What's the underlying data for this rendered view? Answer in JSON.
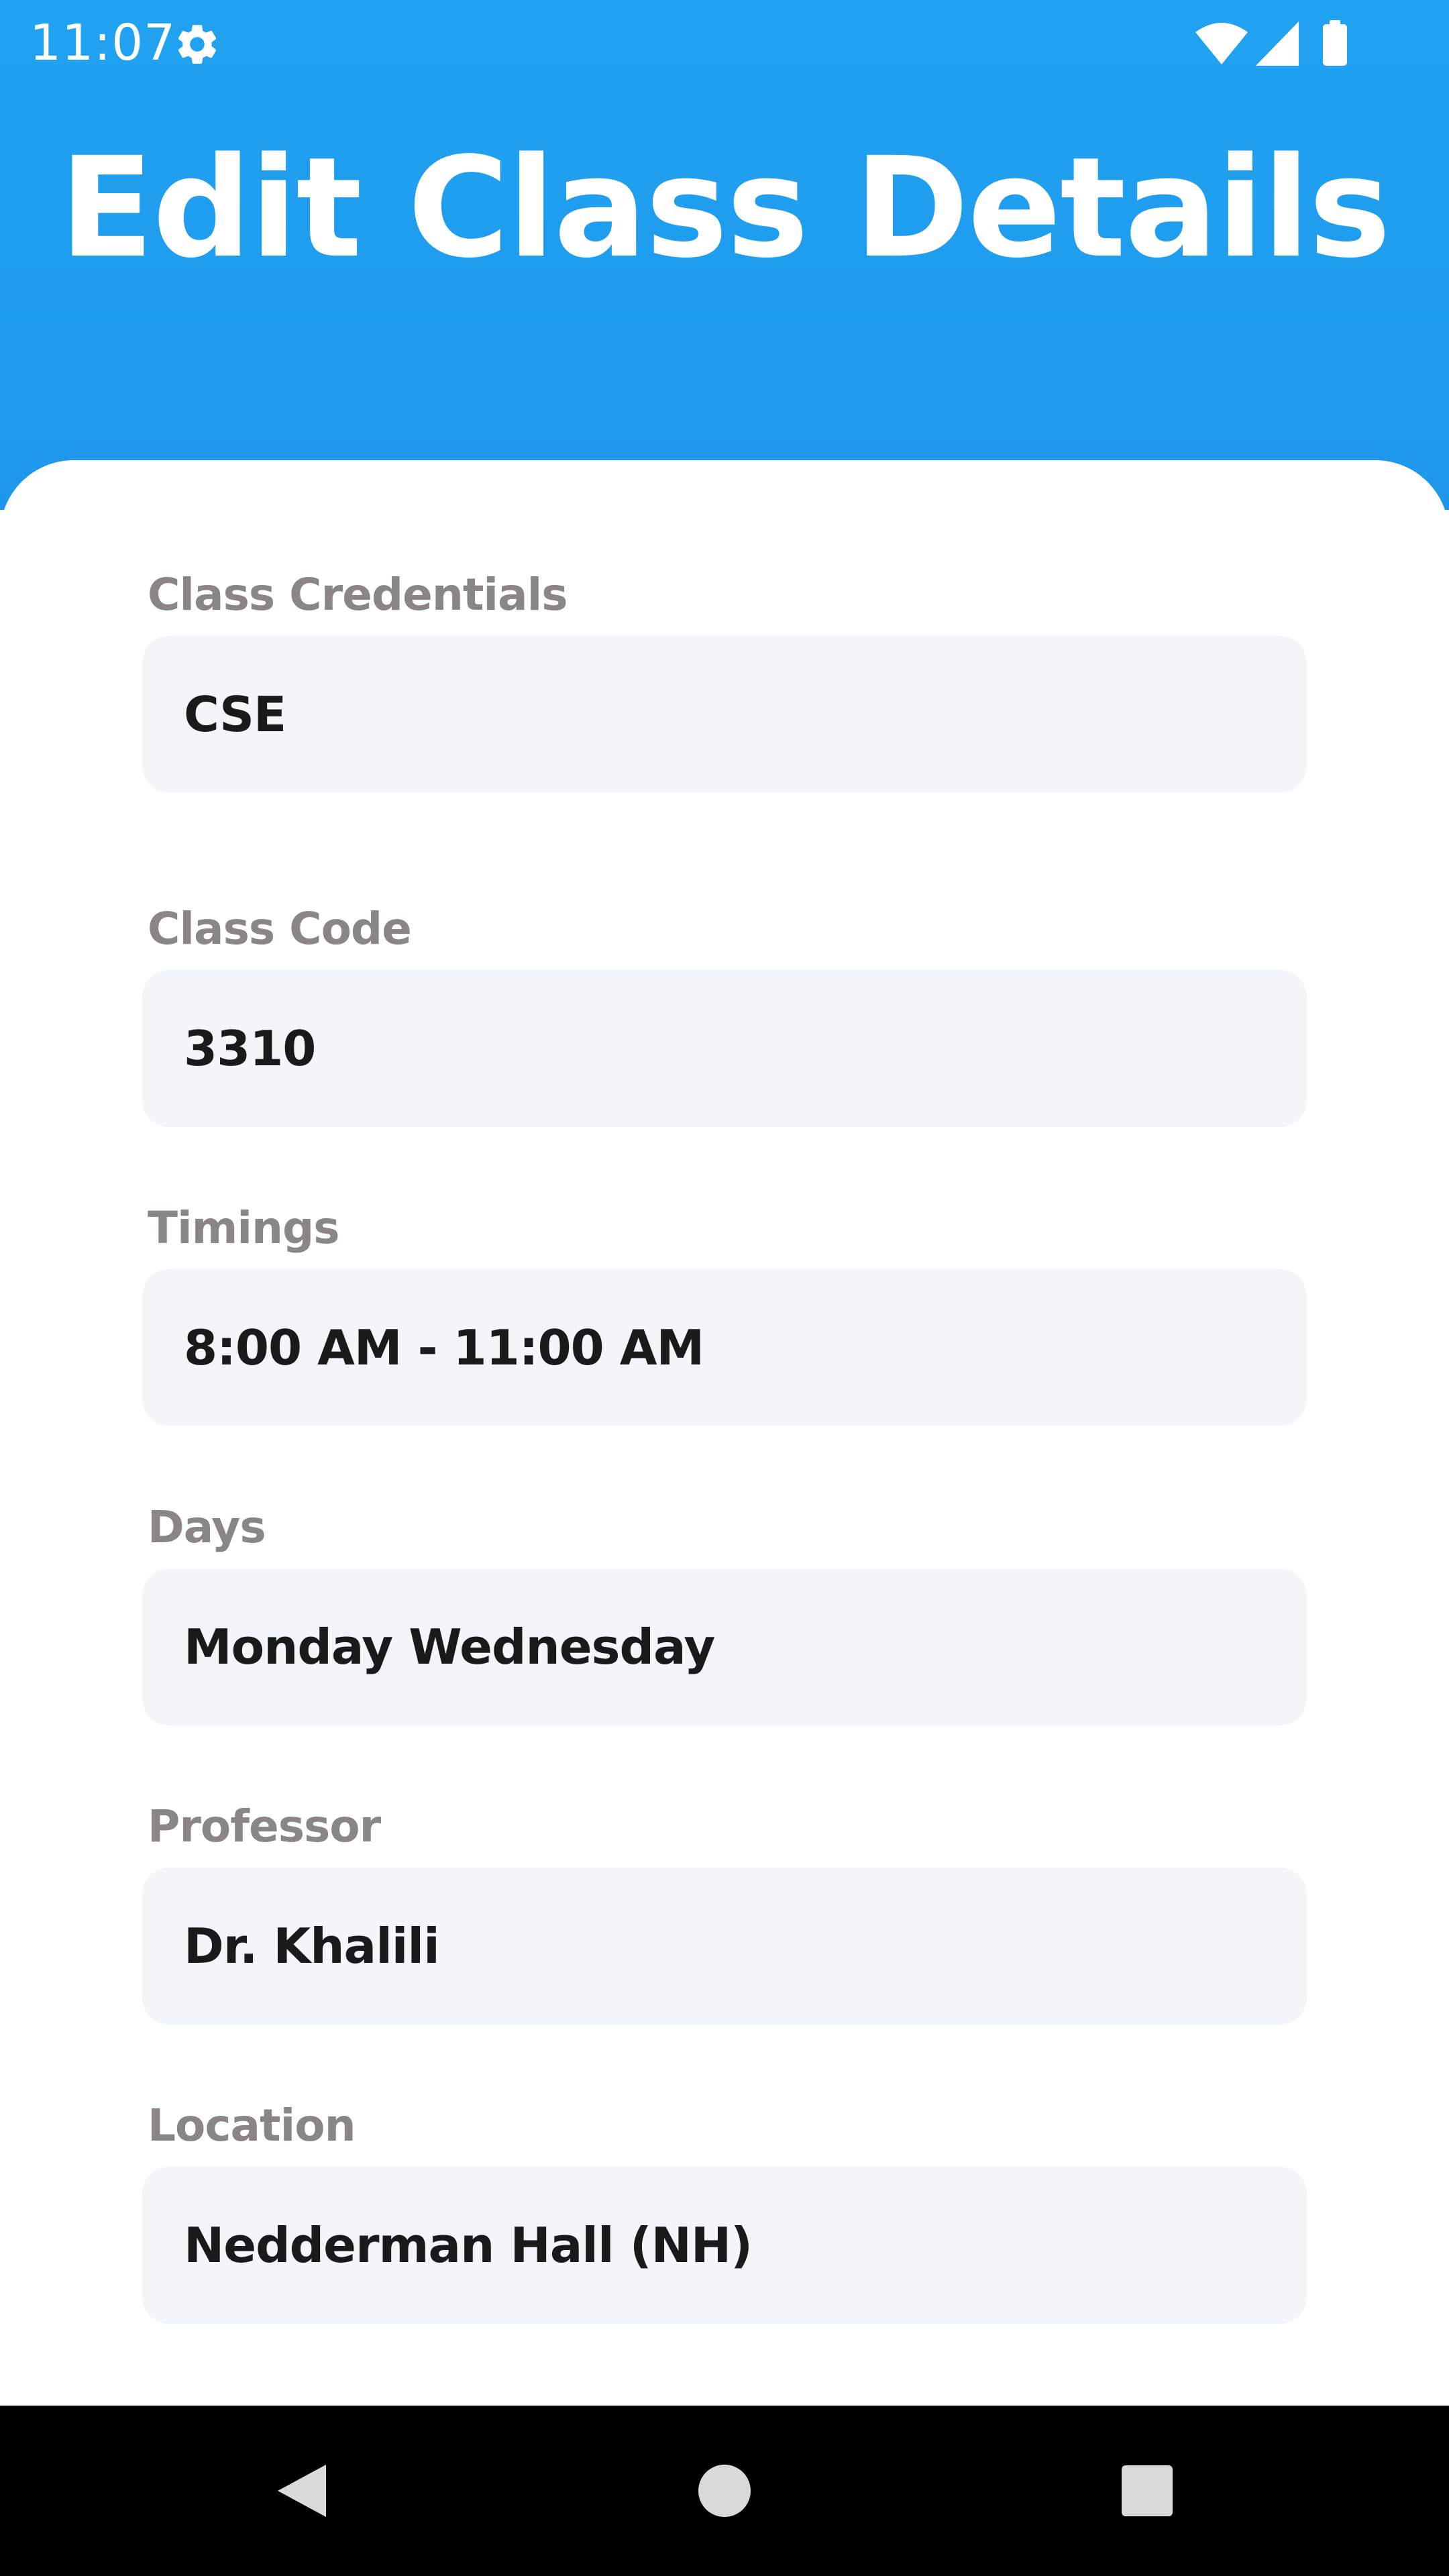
{
  "status_bar": {
    "time": "11:07",
    "icons": [
      "gear-icon",
      "wifi-icon",
      "cell-signal-icon",
      "battery-icon"
    ]
  },
  "header": {
    "title": "Edit Class Details",
    "background_color": "#21a3f1"
  },
  "form": {
    "fields": [
      {
        "label": "Class Credentials",
        "value": "CSE"
      },
      {
        "label": "Class Code",
        "value": "3310"
      },
      {
        "label": "Timings",
        "value": "8:00 AM - 11:00 AM"
      },
      {
        "label": "Days",
        "value": "Monday Wednesday"
      },
      {
        "label": "Professor",
        "value": "Dr. Khalili"
      },
      {
        "label": "Location",
        "value": "Nedderman Hall (NH)"
      }
    ]
  },
  "navigation_bar": {
    "icons": [
      "back-icon",
      "home-icon",
      "recents-icon"
    ]
  }
}
